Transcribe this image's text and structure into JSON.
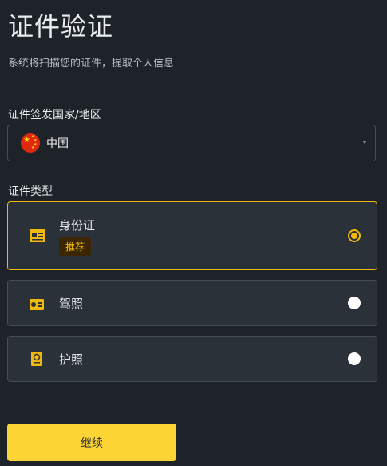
{
  "header": {
    "title": "证件验证",
    "subtitle": "系统将扫描您的证件，提取个人信息"
  },
  "country": {
    "label": "证件签发国家/地区",
    "selected": "中国",
    "flag_icon": "china-flag-icon"
  },
  "doc_type": {
    "label": "证件类型",
    "options": [
      {
        "label": "身份证",
        "badge": "推荐",
        "icon": "id-card-icon",
        "selected": true
      },
      {
        "label": "驾照",
        "icon": "drivers-license-icon",
        "selected": false
      },
      {
        "label": "护照",
        "icon": "passport-icon",
        "selected": false
      }
    ]
  },
  "actions": {
    "continue_label": "继续"
  },
  "colors": {
    "background": "#1e2329",
    "accent": "#f0b90b",
    "button": "#fcd535",
    "card": "#2b3139",
    "border": "#474d57"
  }
}
